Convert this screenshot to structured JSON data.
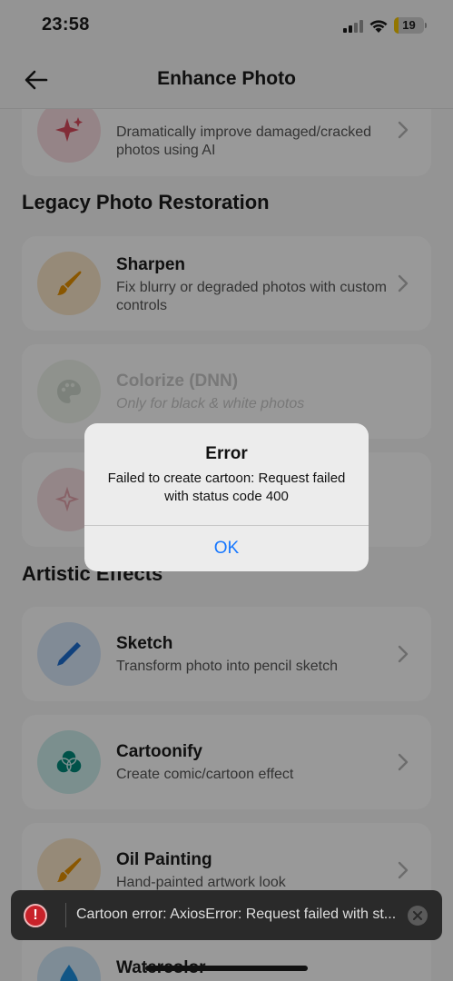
{
  "status_bar": {
    "time": "23:58",
    "battery": "19"
  },
  "header": {
    "title": "Enhance Photo",
    "back_icon": "arrow-left-icon"
  },
  "cards_top": [
    {
      "title": "",
      "description": "Dramatically improve damaged/cracked photos using AI",
      "icon": "sparkle-icon",
      "icon_color": "#d94a5c"
    }
  ],
  "sections": [
    {
      "title": "Legacy Photo Restoration",
      "cards": [
        {
          "title": "Sharpen",
          "description": "Fix blurry or degraded photos with custom controls",
          "icon": "brush-icon",
          "icon_color": "#e69100"
        },
        {
          "title": "Colorize (DNN)",
          "description": "Only for black & white photos",
          "icon": "palette-icon",
          "disabled": true
        },
        {
          "title": "",
          "description": "",
          "icon": "sparkles-icon"
        }
      ]
    },
    {
      "title": "Artistic Effects",
      "cards": [
        {
          "title": "Sketch",
          "description": "Transform photo into pencil sketch",
          "icon": "pencil-icon",
          "icon_color": "#1d6fd1"
        },
        {
          "title": "Cartoonify",
          "description": "Create comic/cartoon effect",
          "icon": "circles-icon",
          "icon_color": "#00897b"
        },
        {
          "title": "Oil Painting",
          "description": "Hand-painted artwork look",
          "icon": "brush-icon",
          "icon_color": "#e69100"
        },
        {
          "title": "Watercolor",
          "description": "",
          "icon": "droplet-icon",
          "icon_color": "#1d8fe0"
        }
      ]
    }
  ],
  "alert": {
    "title": "Error",
    "message": "Failed to create cartoon: Request failed with status code 400",
    "button": "OK"
  },
  "toast": {
    "text": "Cartoon error: AxiosError: Request failed with st...",
    "icon": "error-icon",
    "close_icon": "close-icon"
  }
}
